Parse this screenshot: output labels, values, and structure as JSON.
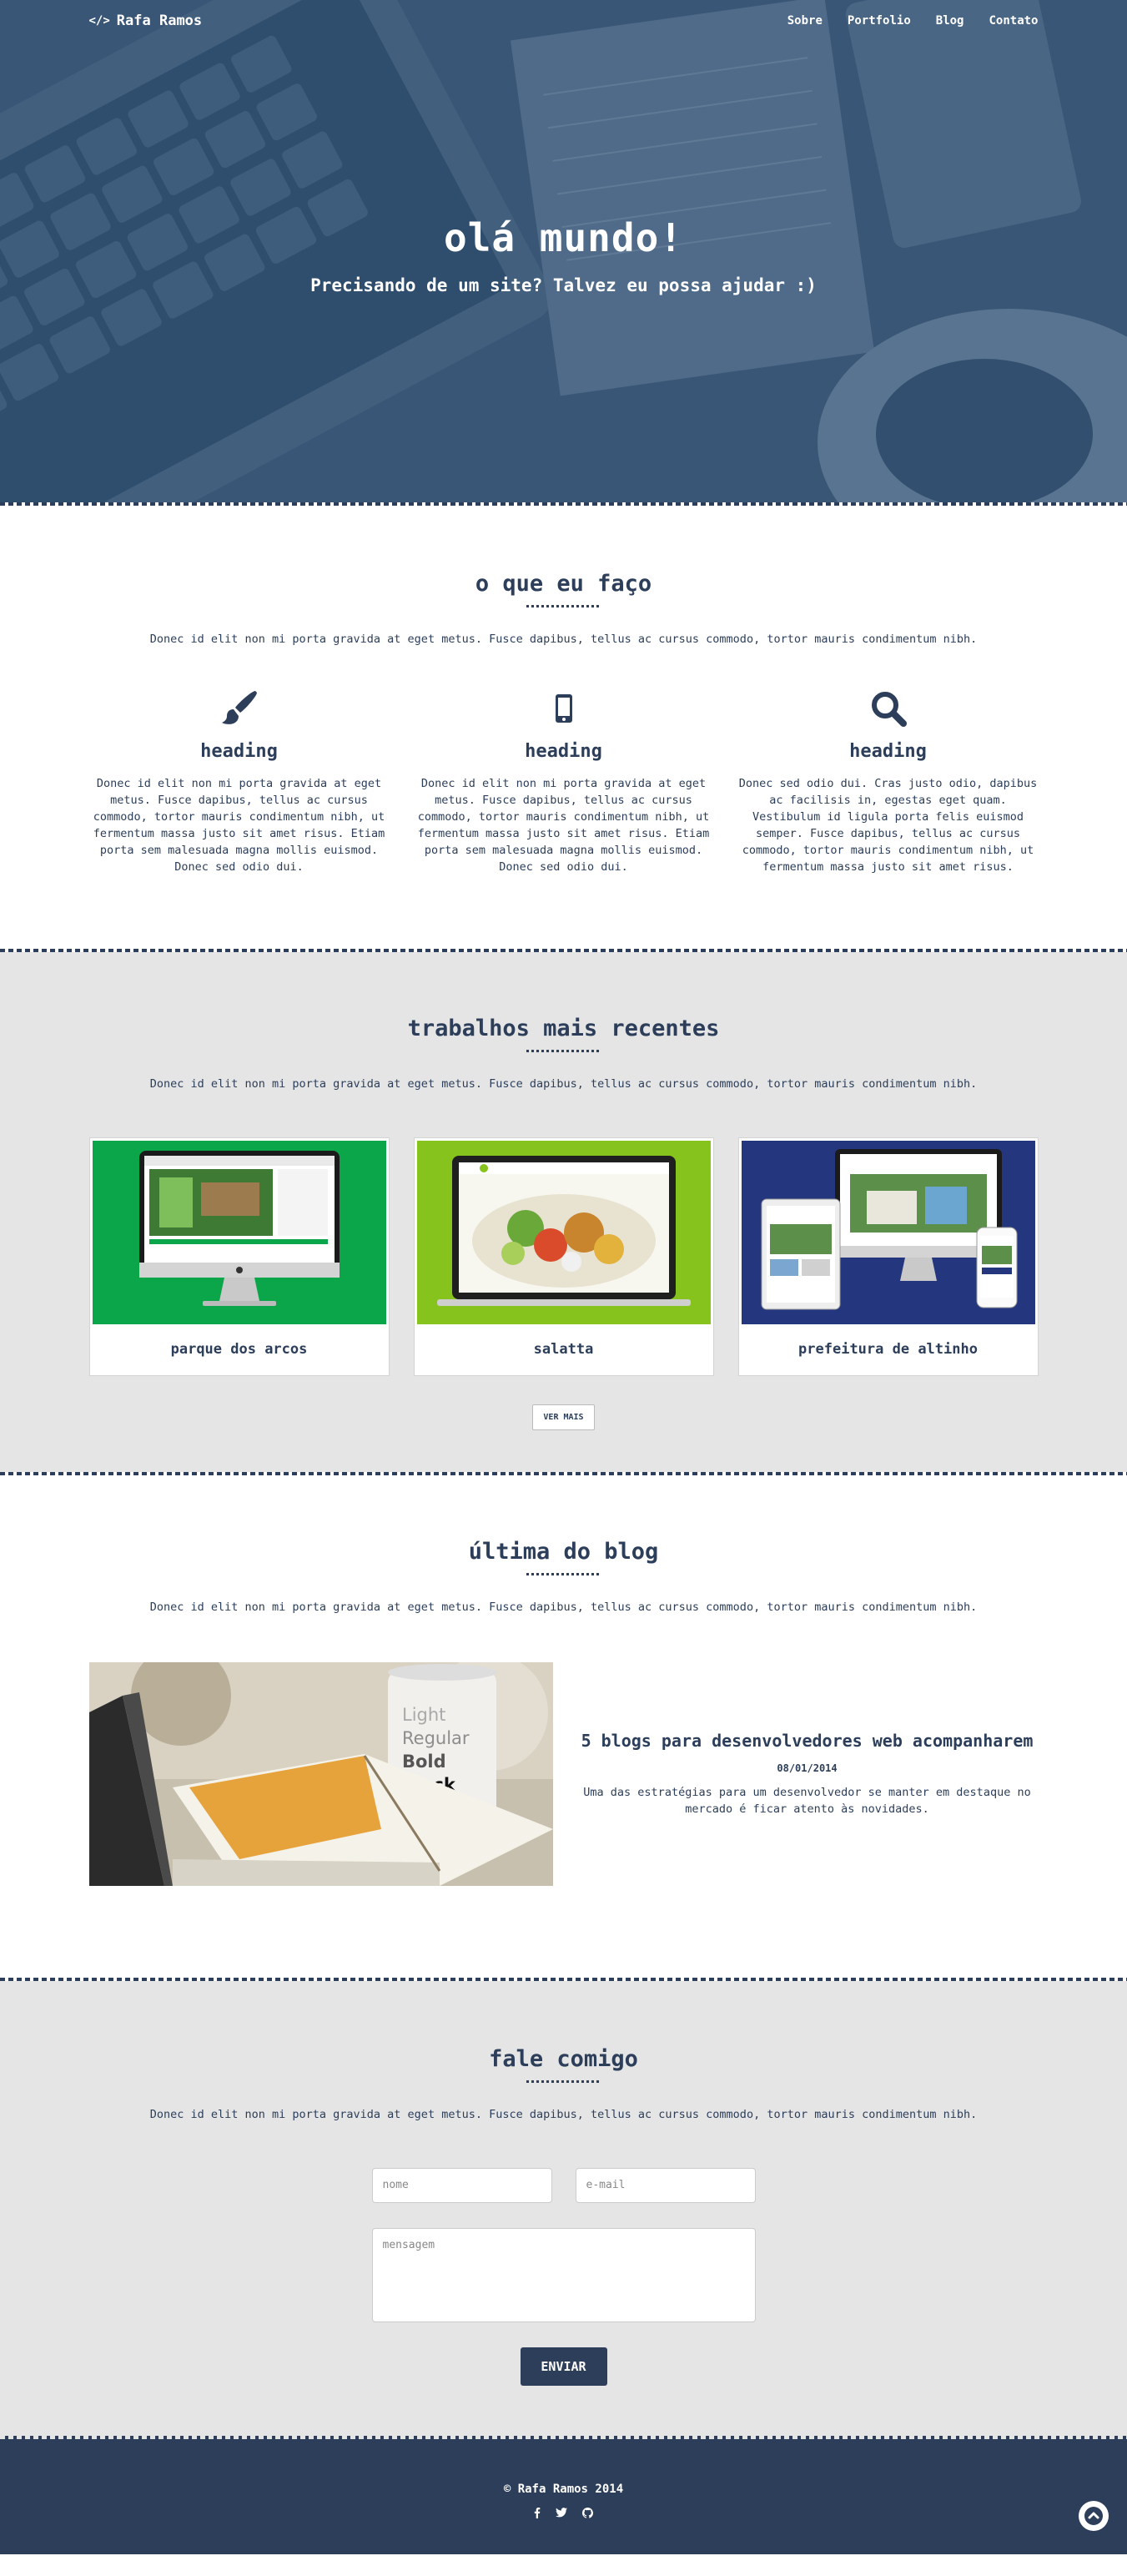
{
  "nav": {
    "brand": "Rafa Ramos",
    "items": [
      "Sobre",
      "Portfolio",
      "Blog",
      "Contato"
    ]
  },
  "hero": {
    "title": "olá mundo!",
    "subtitle": "Precisando de um site? Talvez eu possa ajudar :)"
  },
  "services": {
    "title": "o que eu faço",
    "lead": "Donec id elit non mi porta gravida at eget metus. Fusce dapibus, tellus ac cursus commodo, tortor mauris condimentum nibh.",
    "items": [
      {
        "icon": "paintbrush-icon",
        "heading": "heading",
        "text": "Donec id elit non mi porta gravida at eget metus. Fusce dapibus, tellus ac cursus commodo, tortor mauris condimentum nibh, ut fermentum massa justo sit amet risus. Etiam porta sem malesuada magna mollis euismod. Donec sed odio dui."
      },
      {
        "icon": "mobile-icon",
        "heading": "heading",
        "text": "Donec id elit non mi porta gravida at eget metus. Fusce dapibus, tellus ac cursus commodo, tortor mauris condimentum nibh, ut fermentum massa justo sit amet risus. Etiam porta sem malesuada magna mollis euismod. Donec sed odio dui."
      },
      {
        "icon": "search-icon",
        "heading": "heading",
        "text": "Donec sed odio dui. Cras justo odio, dapibus ac facilisis in, egestas eget quam. Vestibulum id ligula porta felis euismod semper. Fusce dapibus, tellus ac cursus commodo, tortor mauris condimentum nibh, ut fermentum massa justo sit amet risus."
      }
    ]
  },
  "work": {
    "title": "trabalhos mais recentes",
    "lead": "Donec id elit non mi porta gravida at eget metus. Fusce dapibus, tellus ac cursus commodo, tortor mauris condimentum nibh.",
    "items": [
      {
        "name": "parque dos arcos",
        "color": "#0ca64a"
      },
      {
        "name": "salatta",
        "color": "#86c31c"
      },
      {
        "name": "prefeitura de altinho",
        "color": "#24377e"
      }
    ],
    "more": "VER MAIS"
  },
  "blog": {
    "title": "última do blog",
    "lead": "Donec id elit non mi porta gravida at eget metus. Fusce dapibus, tellus ac cursus commodo, tortor mauris condimentum nibh.",
    "post": {
      "title": "5 blogs para desenvolvedores web acompanharem",
      "date": "08/01/2014",
      "excerpt": "Uma das estratégias para um desenvolvedor se manter em destaque no mercado é ficar atento às novidades.",
      "mug_text": [
        "Light",
        "Regular",
        "Bold",
        "Black"
      ]
    }
  },
  "contact": {
    "title": "fale comigo",
    "lead": "Donec id elit non mi porta gravida at eget metus. Fusce dapibus, tellus ac cursus commodo, tortor mauris condimentum nibh.",
    "name_placeholder": "nome",
    "email_placeholder": "e-mail",
    "message_placeholder": "mensagem",
    "send": "ENVIAR"
  },
  "footer": {
    "copyright": "© Rafa Ramos 2014",
    "social": [
      "facebook-icon",
      "twitter-icon",
      "github-icon"
    ]
  },
  "colors": {
    "primary": "#2c3e5a",
    "gray_bg": "#e5e5e5"
  }
}
